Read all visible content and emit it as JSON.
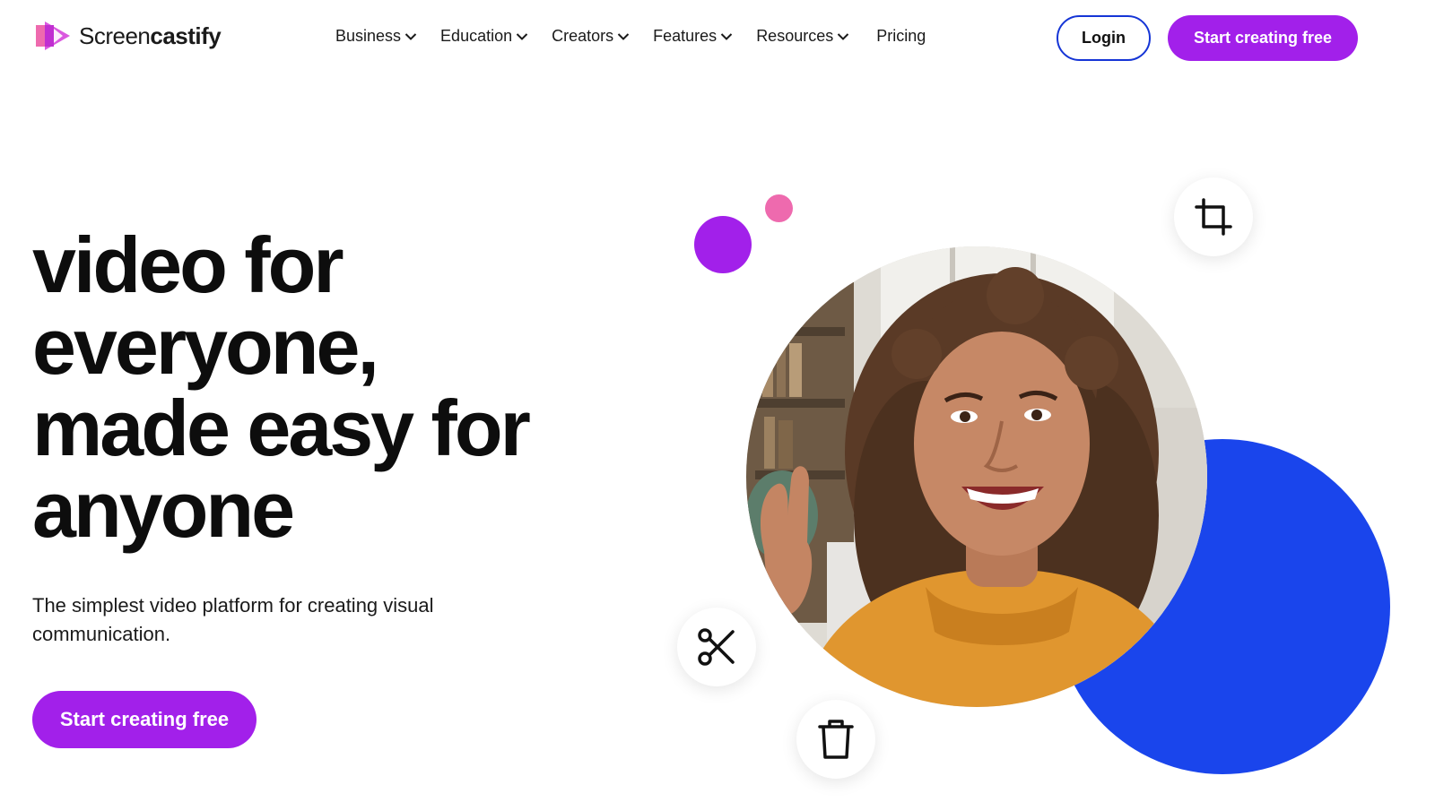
{
  "brand": {
    "name_regular": "Screen",
    "name_bold": "castify",
    "logo_icon": "screencastify-logo-icon",
    "colors": {
      "purple": "#a220ea",
      "pink": "#ee6aae",
      "blue": "#1a45ec",
      "login_border": "#1535d6"
    }
  },
  "nav": {
    "items": [
      {
        "label": "Business",
        "dropdown": true
      },
      {
        "label": "Education",
        "dropdown": true
      },
      {
        "label": "Creators",
        "dropdown": true
      },
      {
        "label": "Features",
        "dropdown": true
      },
      {
        "label": "Resources",
        "dropdown": true
      },
      {
        "label": "Pricing",
        "dropdown": false
      }
    ],
    "dropdown_icon": "chevron-down-icon"
  },
  "header": {
    "login_label": "Login",
    "cta_label": "Start creating free"
  },
  "hero": {
    "title_lines": [
      "video for",
      "everyone,",
      "made easy for",
      "anyone"
    ],
    "subtitle": "The simplest video platform for creating visual communication.",
    "cta_label": "Start creating free"
  },
  "visual": {
    "photo": "smiling-woman-waving-photo",
    "tools": [
      "crop-icon",
      "scissors-icon",
      "trash-icon"
    ]
  }
}
